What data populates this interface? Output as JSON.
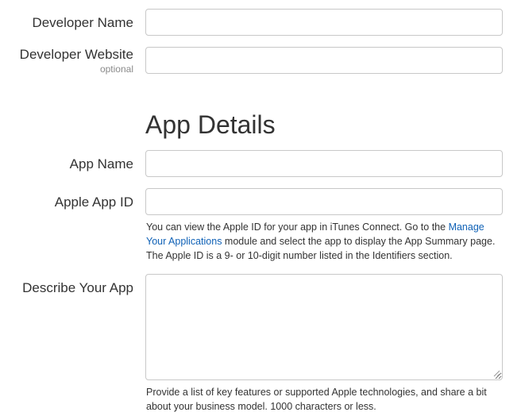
{
  "form": {
    "developer_name": {
      "label": "Developer Name",
      "value": "",
      "placeholder": ""
    },
    "developer_website": {
      "label": "Developer Website",
      "optional_hint": "optional",
      "value": "",
      "placeholder": ""
    }
  },
  "app_details": {
    "heading": "App Details",
    "app_name": {
      "label": "App Name",
      "value": "",
      "placeholder": ""
    },
    "apple_app_id": {
      "label": "Apple App ID",
      "value": "",
      "placeholder": "",
      "help_prefix": "You can view the Apple ID for your app in iTunes Connect. Go to the ",
      "help_link": "Manage Your Applications",
      "help_suffix": " module and select the app to display the App Summary page. The Apple ID is a 9- or 10-digit number listed in the Identifiers section."
    },
    "describe_app": {
      "label": "Describe Your App",
      "value": "",
      "placeholder": "",
      "help": "Provide a list of key features or supported Apple technologies, and share a bit about your business model. 1000 characters or less."
    }
  },
  "colors": {
    "link": "#0f61b6",
    "text": "#333333",
    "muted": "#8a8a8a",
    "border": "#c8c8c8"
  }
}
